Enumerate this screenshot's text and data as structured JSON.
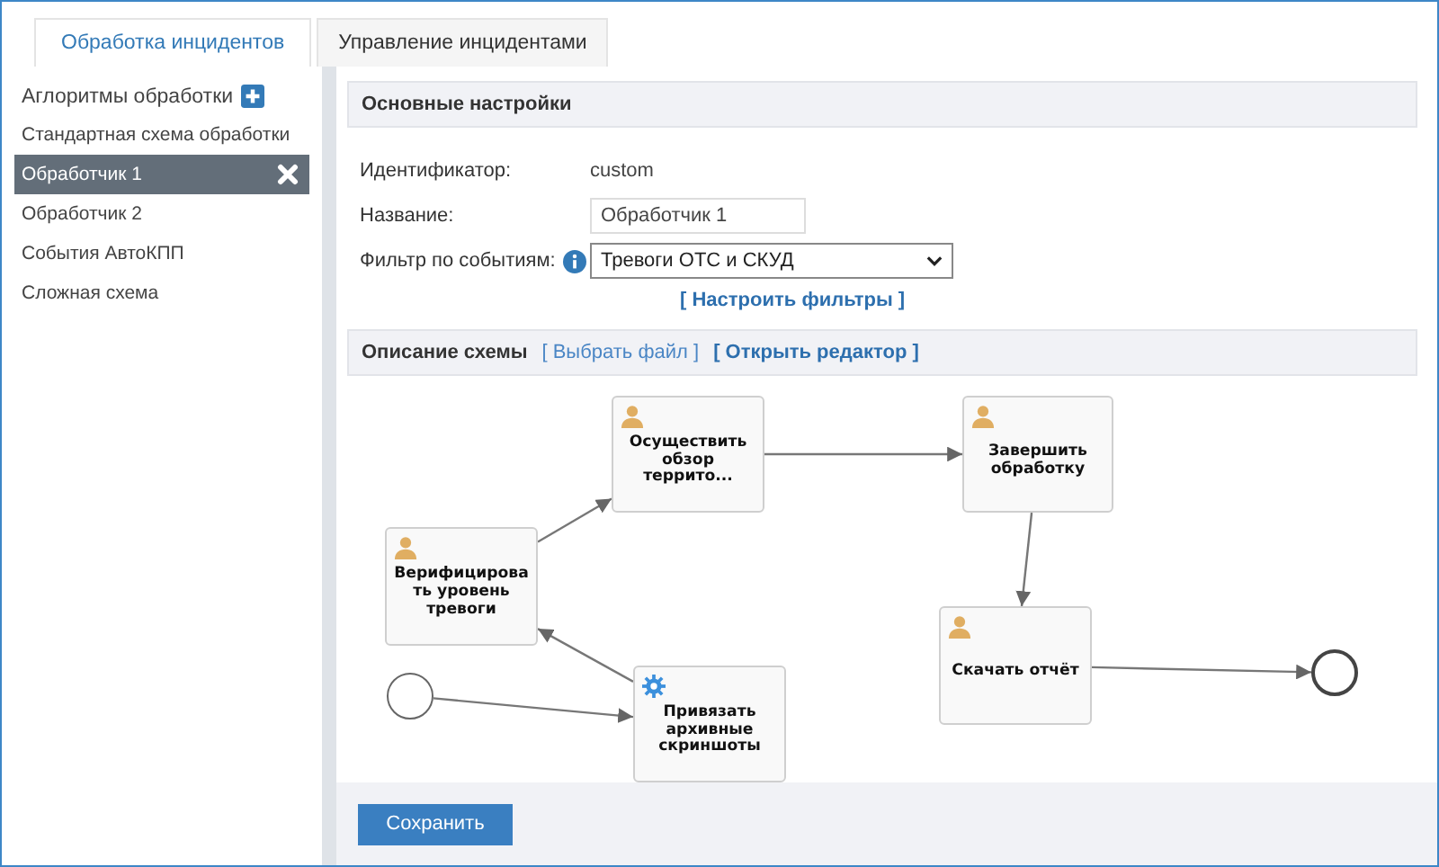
{
  "tabs": [
    {
      "label": "Обработка инцидентов",
      "selected": true
    },
    {
      "label": "Управление инцидентами",
      "selected": false
    }
  ],
  "sidebar": {
    "title": "Аглоритмы обработки",
    "items": [
      {
        "label": "Стандартная схема обработки",
        "selected": false
      },
      {
        "label": "Обработчик 1",
        "selected": true
      },
      {
        "label": "Обработчик 2",
        "selected": false
      },
      {
        "label": "События АвтоКПП",
        "selected": false
      },
      {
        "label": "Сложная схема",
        "selected": false
      }
    ]
  },
  "settings": {
    "title": "Основные настройки",
    "id_label": "Идентификатор:",
    "id_value": "custom",
    "name_label": "Название:",
    "name_value": "Обработчик 1",
    "filter_label": "Фильтр по событиям:",
    "filter_value": "Тревоги ОТС и СКУД",
    "filter_link": "[ Настроить фильтры ]"
  },
  "scheme": {
    "title": "Описание схемы",
    "choose_file": "[ Выбрать файл ]",
    "open_editor": "[ Открыть редактор ]",
    "nodes": [
      {
        "kind": "start"
      },
      {
        "kind": "service",
        "label": "Привязать архивные скриншоты"
      },
      {
        "kind": "user",
        "label": "Верифицировать уровень тревоги"
      },
      {
        "kind": "user",
        "label": "Осуществить обзор террито..."
      },
      {
        "kind": "user",
        "label": "Завершить обработку"
      },
      {
        "kind": "user",
        "label": "Скачать отчёт"
      },
      {
        "kind": "end"
      }
    ]
  },
  "buttons": [
    "Сохранить"
  ]
}
